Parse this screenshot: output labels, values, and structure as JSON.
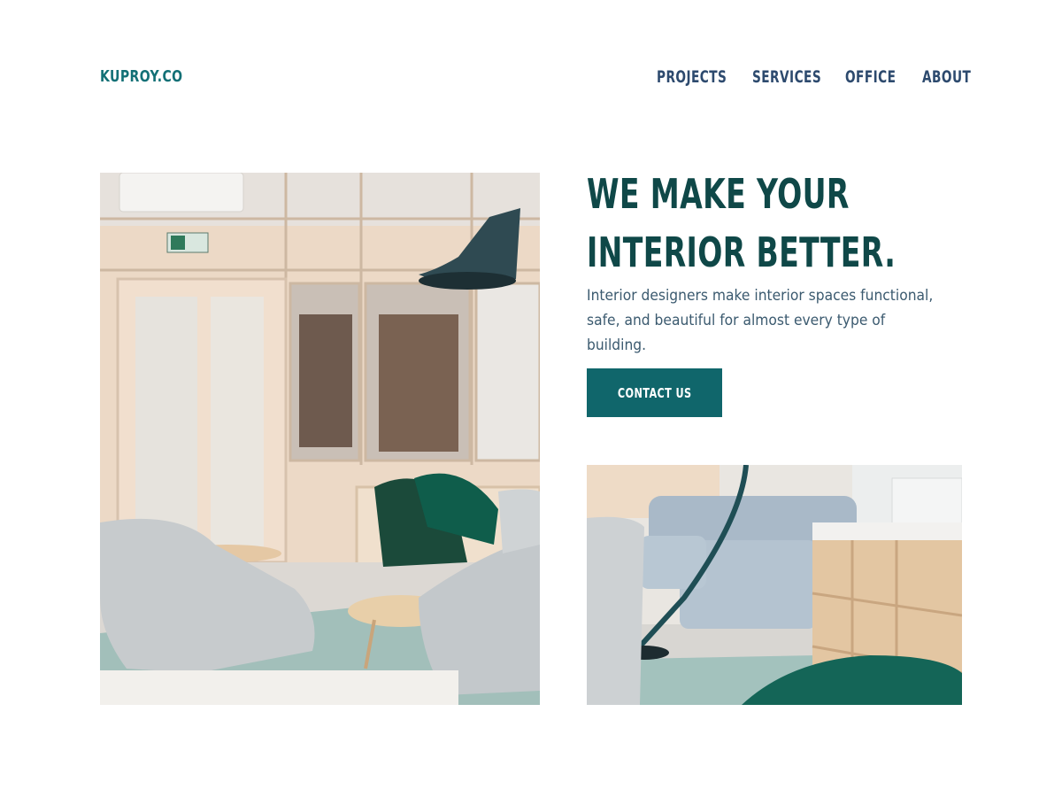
{
  "brand": {
    "logo_text": "KUPROY.CO",
    "accent_color": "#137076"
  },
  "nav": {
    "items": [
      {
        "label": "PROJECTS"
      },
      {
        "label": "SERVICES"
      },
      {
        "label": "OFFICE"
      },
      {
        "label": "ABOUT"
      }
    ]
  },
  "hero": {
    "headline_line1": "WE MAKE YOUR",
    "headline_line2": "INTERIOR BETTER.",
    "description": "Interior designers make interior spaces functional, safe, and beautiful for almost every type of building.",
    "cta_label": "CONTACT US",
    "cta_color": "#10666b",
    "headline_color": "#0f4848"
  },
  "images": {
    "main_photo": "office-lounge-photo",
    "secondary_photo": "living-room-photo"
  }
}
